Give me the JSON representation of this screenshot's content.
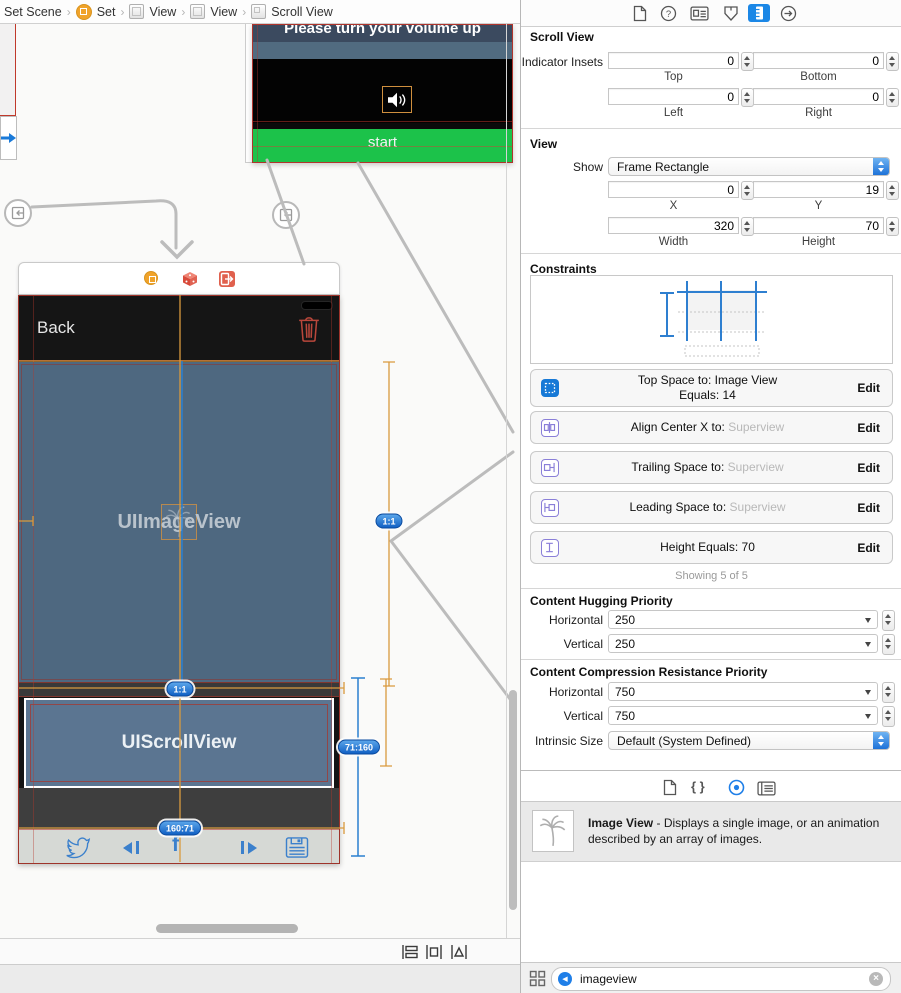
{
  "jump_bar": {
    "items": [
      "Set Scene",
      "Set",
      "View",
      "View",
      "Scroll View"
    ],
    "separator": "›",
    "back_chevron": "‹",
    "forward_chevron": "›"
  },
  "canvas": {
    "top_scene": {
      "title_label": "Please turn your volume up",
      "start_button": "start"
    },
    "main_scene": {
      "back_label": "Back",
      "imageview_label": "UIImageView",
      "scrollview_label": "UIScrollView"
    },
    "badges": {
      "imageview_ratio": "1:1",
      "row_ratio": "1:1",
      "scroll_ratio": "71:160",
      "toolbar_ratio": "160:71"
    }
  },
  "inspector": {
    "scroll_view": {
      "title": "Scroll View",
      "indicator_insets_label": "Indicator Insets",
      "insets": [
        {
          "value": "0",
          "label": "Top"
        },
        {
          "value": "0",
          "label": "Bottom"
        },
        {
          "value": "0",
          "label": "Left"
        },
        {
          "value": "0",
          "label": "Right"
        }
      ]
    },
    "view": {
      "title": "View",
      "show_label": "Show",
      "show_value": "Frame Rectangle",
      "frame": [
        {
          "value": "0",
          "label": "X"
        },
        {
          "value": "19",
          "label": "Y"
        },
        {
          "value": "320",
          "label": "Width"
        },
        {
          "value": "70",
          "label": "Height"
        }
      ]
    },
    "constraints": {
      "title": "Constraints",
      "items": [
        {
          "line1_label": "Top Space to:",
          "line1_value": "Image View",
          "line2_label": "Equals:",
          "line2_value": "14",
          "edit": "Edit"
        },
        {
          "line1_label": "Align Center X to:",
          "line1_value": "Superview",
          "edit": "Edit"
        },
        {
          "line1_label": "Trailing Space to:",
          "line1_value": "Superview",
          "edit": "Edit"
        },
        {
          "line1_label": "Leading Space to:",
          "line1_value": "Superview",
          "edit": "Edit"
        },
        {
          "line1_label": "Height Equals:",
          "line1_value": "70",
          "edit": "Edit"
        }
      ],
      "showing": "Showing 5 of 5"
    },
    "hugging": {
      "title": "Content Hugging Priority",
      "horizontal_label": "Horizontal",
      "horizontal_value": "250",
      "vertical_label": "Vertical",
      "vertical_value": "250"
    },
    "compression": {
      "title": "Content Compression Resistance Priority",
      "horizontal_label": "Horizontal",
      "horizontal_value": "750",
      "vertical_label": "Vertical",
      "vertical_value": "750"
    },
    "intrinsic": {
      "label": "Intrinsic Size",
      "value": "Default (System Defined)"
    }
  },
  "library": {
    "braces_glyph": "{ }",
    "item_title": "Image View",
    "item_description": "- Displays a single image, or an animation described by an array of images.",
    "search_value": "imageview"
  }
}
